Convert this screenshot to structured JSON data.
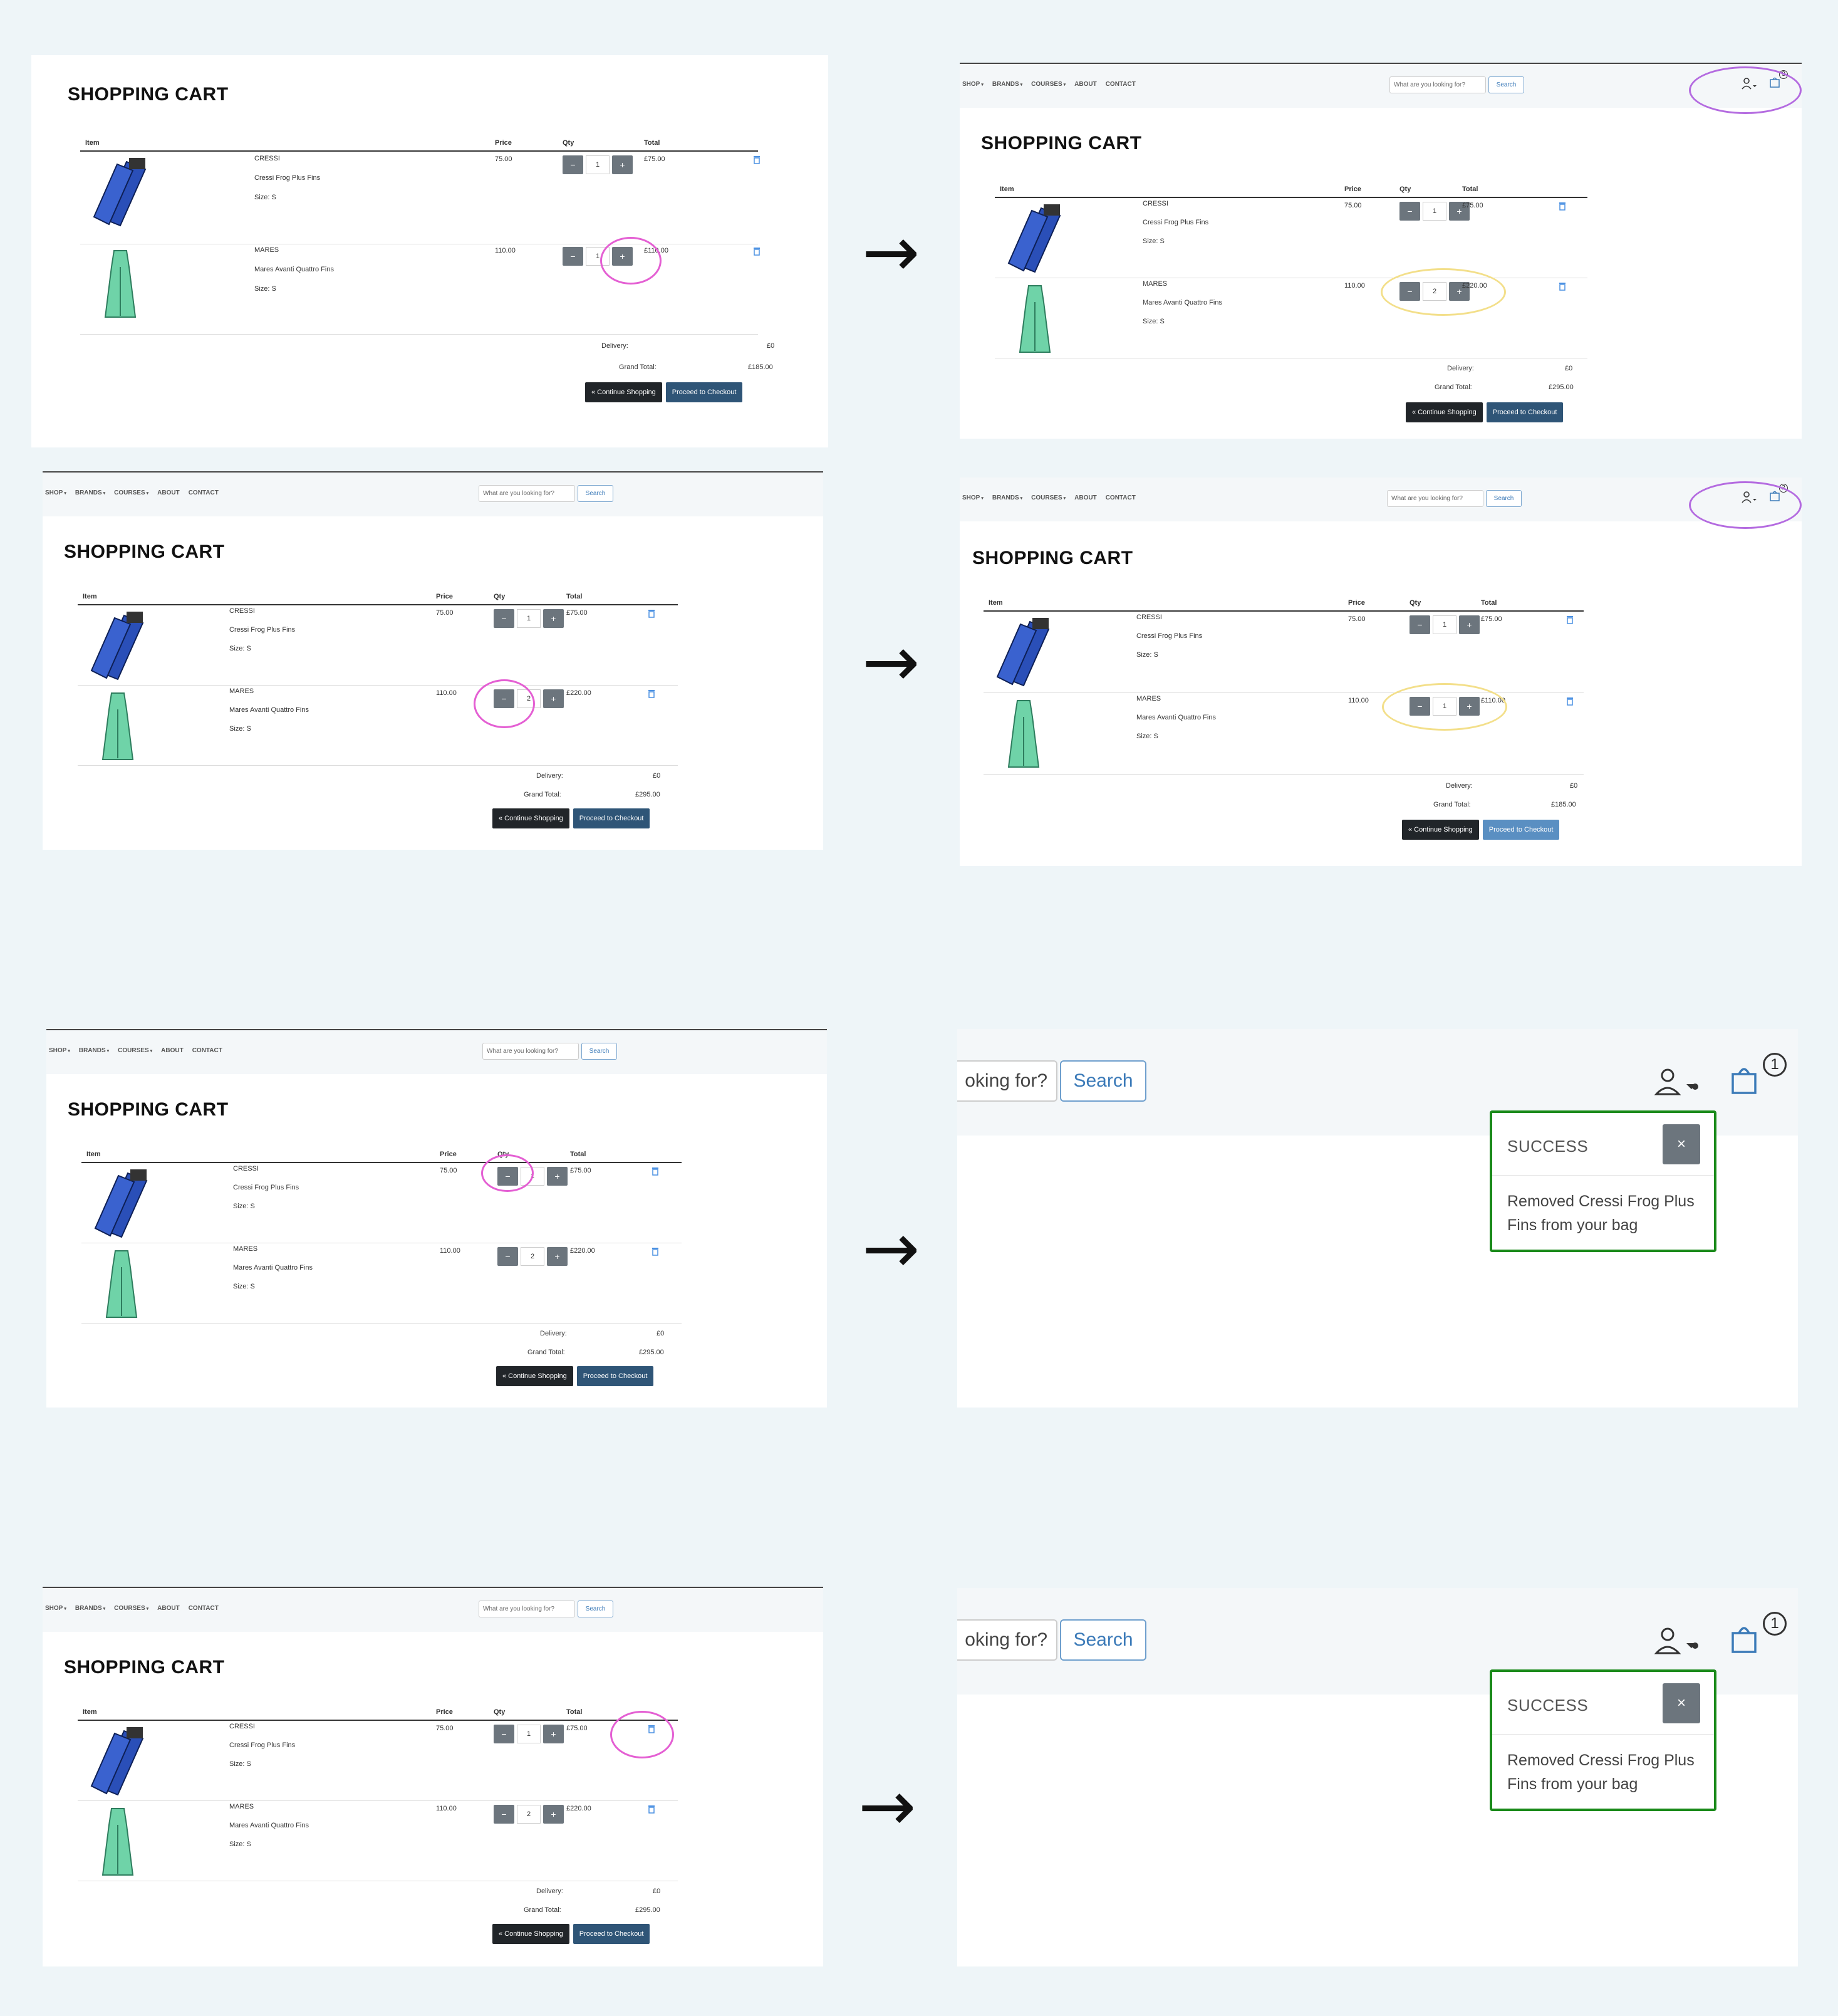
{
  "nav": {
    "menu": [
      "SHOP",
      "BRANDS",
      "COURSES",
      "ABOUT",
      "CONTACT"
    ],
    "search_placeholder": "What are you looking for?",
    "search_button": "Search",
    "search_zoom_text": "oking for?"
  },
  "cart": {
    "title": "SHOPPING CART",
    "headers": {
      "item": "Item",
      "price": "Price",
      "qty": "Qty",
      "total": "Total"
    },
    "items": [
      {
        "brand": "CRESSI",
        "name": "Cressi Frog Plus Fins",
        "size": "Size: S",
        "price": "75.00",
        "color": "#2a4fb8"
      },
      {
        "brand": "MARES",
        "name": "Mares Avanti Quattro Fins",
        "size": "Size: S",
        "price": "110.00",
        "color": "#6fd3a8"
      }
    ],
    "delivery_label": "Delivery:",
    "delivery_value": "£0",
    "grand_total_label": "Grand Total:",
    "continue_label": "« Continue Shopping",
    "checkout_label": "Proceed to Checkout",
    "minus": "−",
    "plus": "+"
  },
  "steps": [
    {
      "left": {
        "q1": "1",
        "t1": "£75.00",
        "q2": "1",
        "t2": "£110.00",
        "grand": "£185.00"
      },
      "right": {
        "q1": "1",
        "t1": "£75.00",
        "q2": "2",
        "t2": "£220.00",
        "grand": "£295.00",
        "badge": "3"
      }
    },
    {
      "left": {
        "q1": "1",
        "t1": "£75.00",
        "q2": "2",
        "t2": "£220.00",
        "grand": "£295.00"
      },
      "right": {
        "q1": "1",
        "t1": "£75.00",
        "q2": "1",
        "t2": "£110.00",
        "grand": "£185.00",
        "badge": "2"
      }
    },
    {
      "left": {
        "q1": "1",
        "t1": "£75.00",
        "q2": "2",
        "t2": "£220.00",
        "grand": "£295.00"
      },
      "right": {
        "badge": "1"
      }
    },
    {
      "left": {
        "q1": "1",
        "t1": "£75.00",
        "q2": "2",
        "t2": "£220.00",
        "grand": "£295.00"
      },
      "right": {
        "badge": "1"
      }
    }
  ],
  "toast": {
    "title": "SUCCESS",
    "close": "×",
    "message": "Removed Cressi Frog Plus Fins from your bag"
  },
  "arrow": "→",
  "icons": [
    "user-icon",
    "bag-icon",
    "trash-icon",
    "fin-image"
  ]
}
